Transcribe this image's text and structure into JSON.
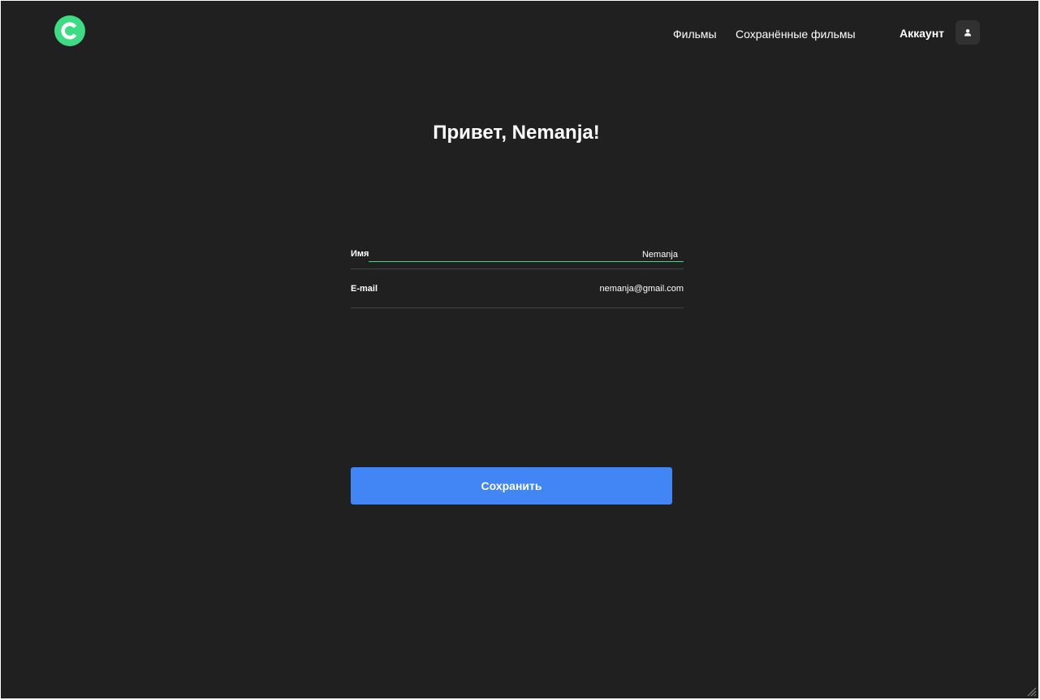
{
  "header": {
    "logo_icon": "c-logo-icon",
    "logo_color": "#3ddc84",
    "nav": {
      "films": "Фильмы",
      "saved_films": "Сохранённые фильмы",
      "account": "Аккаунт"
    },
    "account_icon": "user-icon"
  },
  "main": {
    "greeting": "Привет, Nemanja!",
    "fields": {
      "name_label": "Имя",
      "name_value": "Nemanja",
      "email_label": "E-mail",
      "email_value": "nemanja@gmail.com"
    },
    "save_label": "Сохранить"
  },
  "colors": {
    "background": "#202020",
    "accent_green": "#3ddc84",
    "button_blue": "#4285f4",
    "divider": "#424242"
  }
}
